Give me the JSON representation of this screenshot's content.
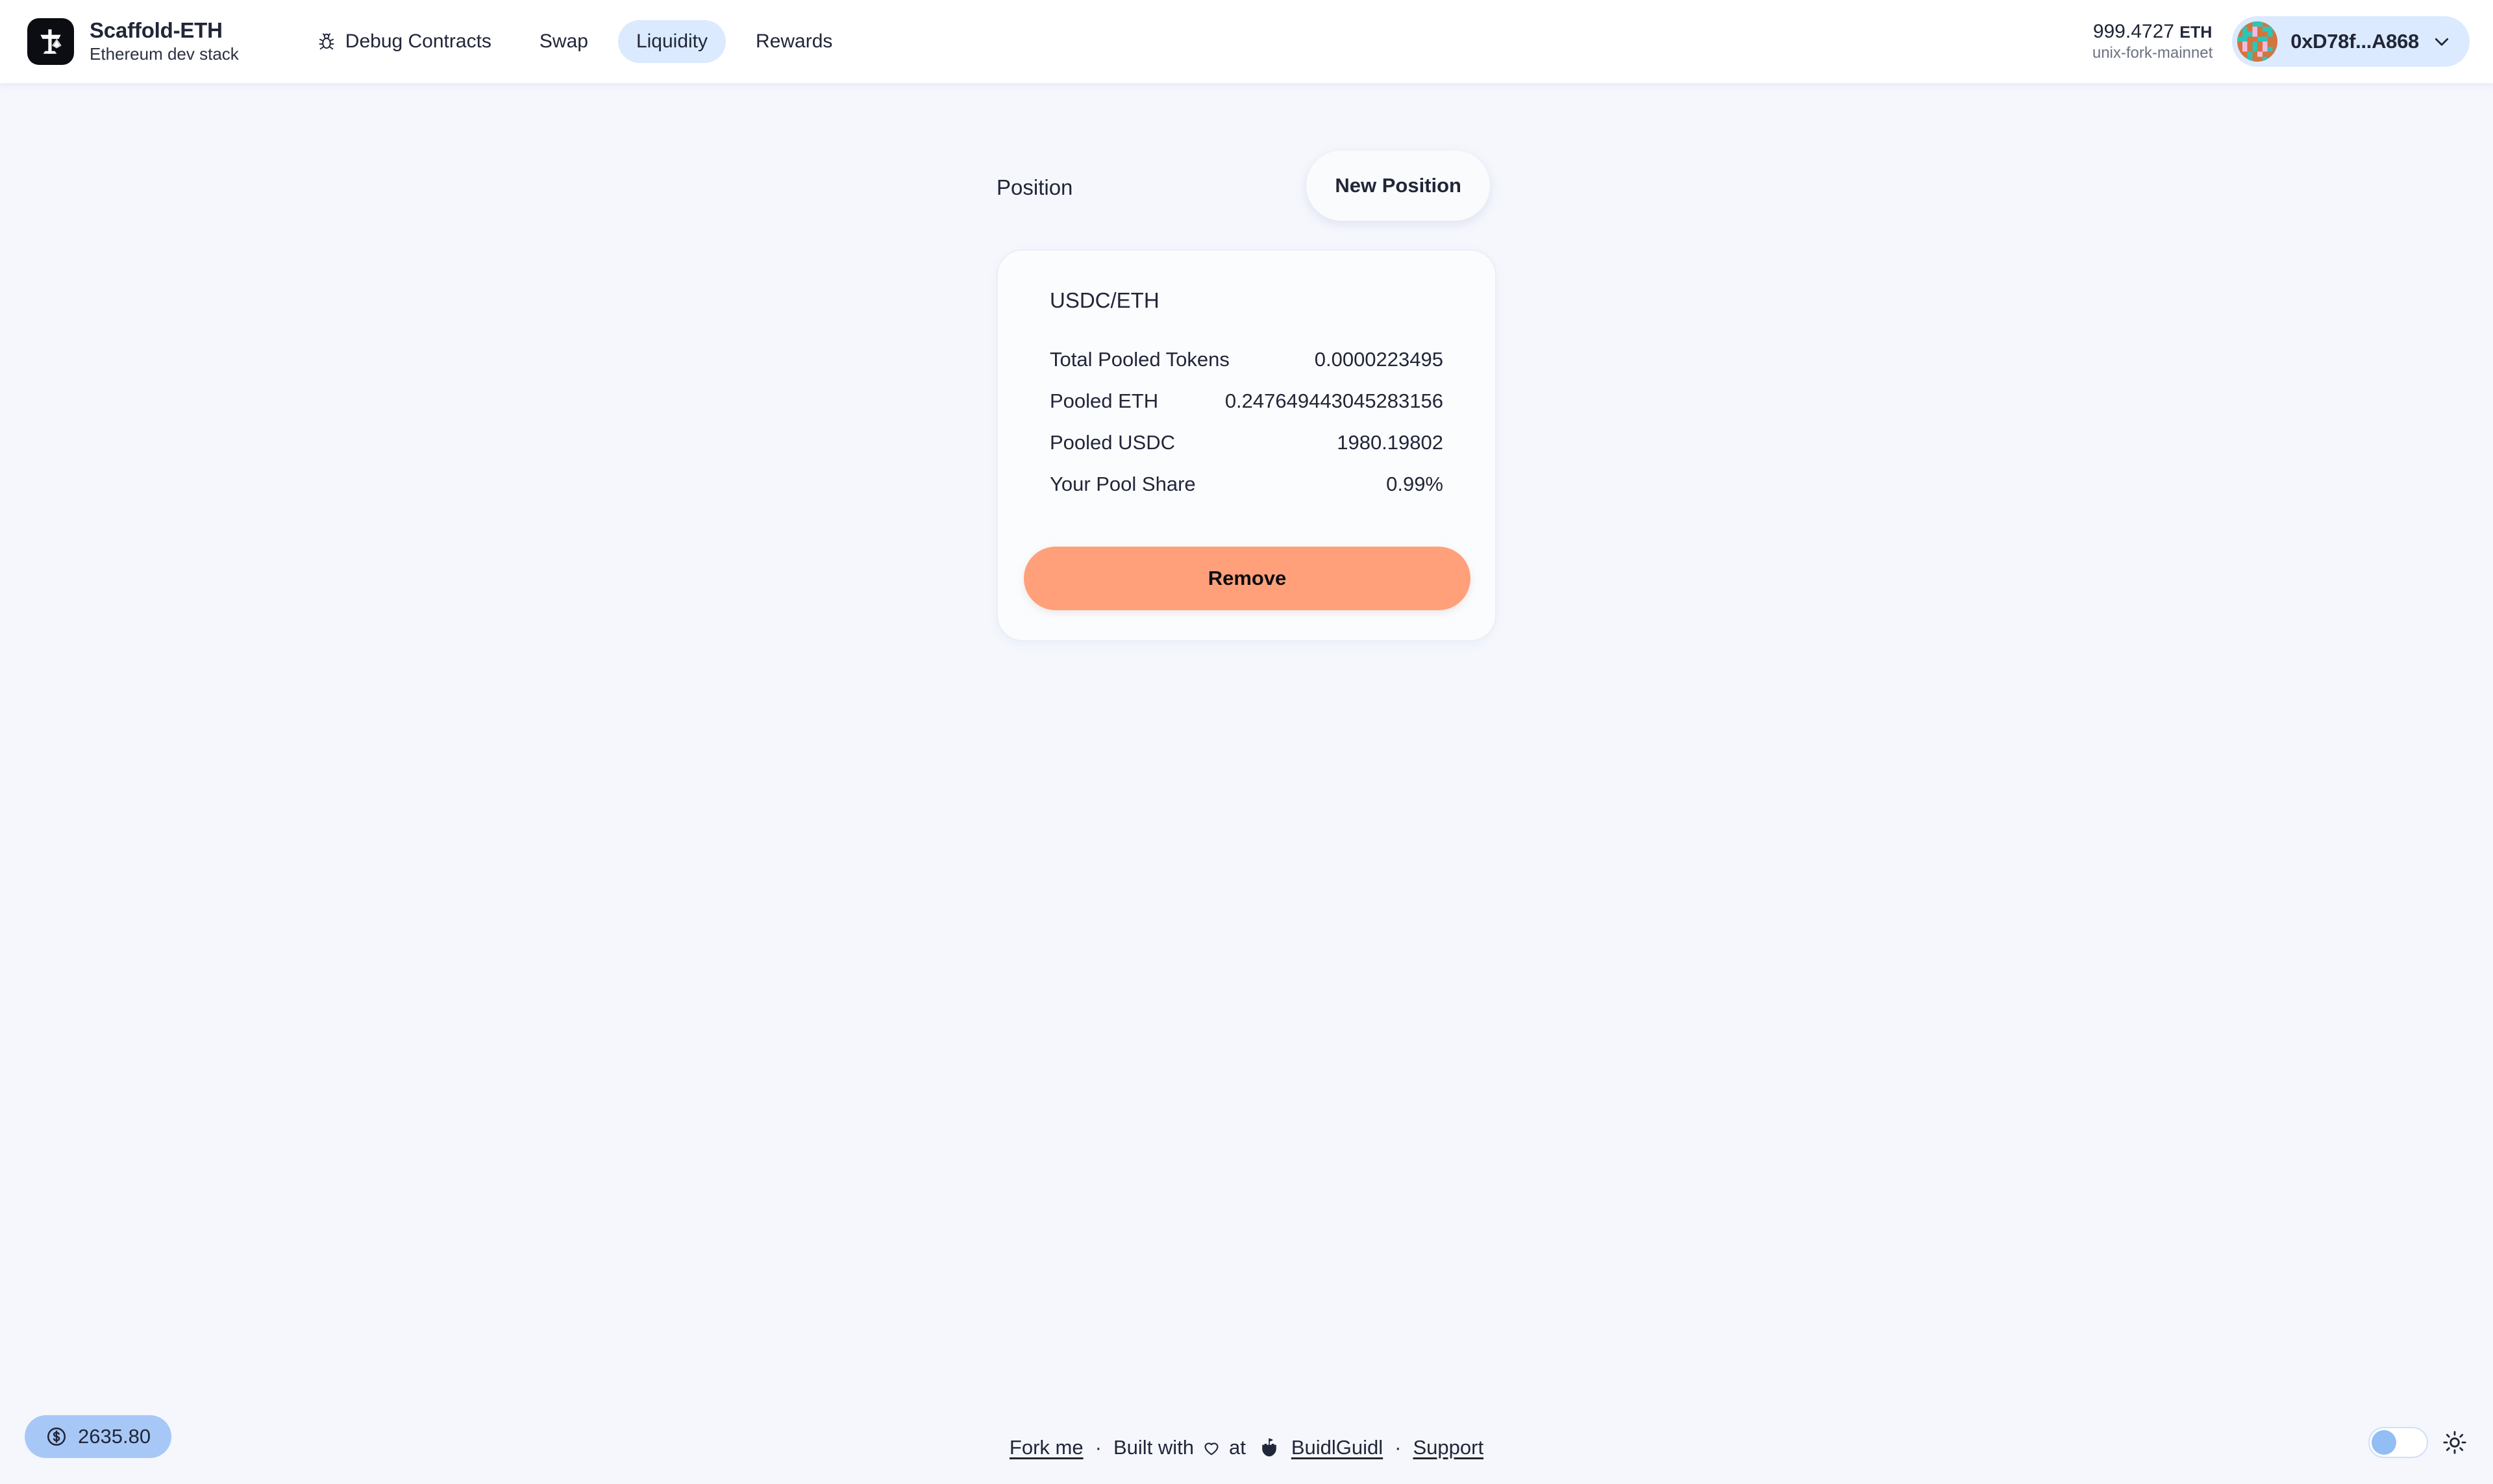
{
  "header": {
    "logo_icon": "scaffold-eth-logo-icon",
    "brand_name": "Scaffold-ETH",
    "brand_subtitle": "Ethereum dev stack",
    "nav": [
      {
        "label": "Debug Contracts",
        "icon": "bug-icon",
        "active": false
      },
      {
        "label": "Swap",
        "icon": null,
        "active": false
      },
      {
        "label": "Liquidity",
        "icon": null,
        "active": true
      },
      {
        "label": "Rewards",
        "icon": null,
        "active": false
      }
    ],
    "balance_amount": "999.4727",
    "balance_unit": "ETH",
    "network": "unix-fork-mainnet",
    "wallet_address": "0xD78f...A868",
    "avatar_icon": "blockie-avatar",
    "chevron_icon": "chevron-down-icon"
  },
  "main": {
    "panel_title": "Position",
    "new_position_label": "New Position",
    "position": {
      "pair": "USDC/ETH",
      "stats": [
        {
          "label": "Total Pooled Tokens",
          "value": "0.0000223495"
        },
        {
          "label": "Pooled ETH",
          "value": "0.247649443045283156"
        },
        {
          "label": "Pooled USDC",
          "value": "1980.19802"
        },
        {
          "label": "Your Pool Share",
          "value": "0.99%"
        }
      ],
      "remove_label": "Remove"
    }
  },
  "footer": {
    "price_badge": {
      "icon": "dollar-circle-icon",
      "value": "2635.80"
    },
    "fork_me": "Fork me",
    "sep1": "·",
    "built_with": "Built with",
    "heart_icon": "heart-icon",
    "at": "at",
    "buidlguidl_icon": "buidlguidl-castle-icon",
    "buidlguidl": "BuidlGuidl",
    "sep2": "·",
    "support": "Support",
    "theme_toggle_icon": "theme-toggle",
    "sun_icon": "sun-icon"
  },
  "colors": {
    "page_bg": "#f5f7fd",
    "header_bg": "#ffffff",
    "accent_blue": "#dbeafe",
    "remove_orange": "#ffa07a",
    "text": "#212638",
    "muted": "#6b7280",
    "price_badge_bg": "#a7c8f7"
  }
}
